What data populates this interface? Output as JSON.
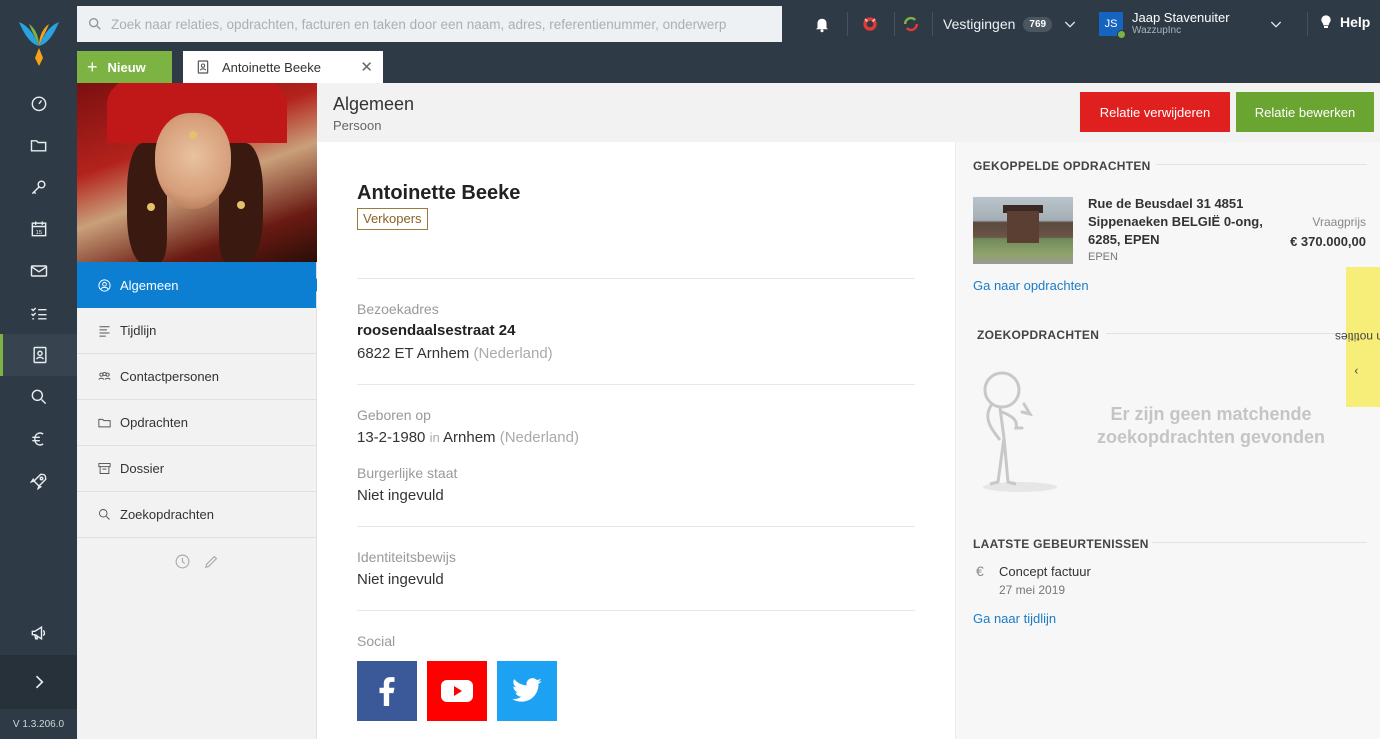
{
  "app": {
    "version": "V 1.3.206.0"
  },
  "search": {
    "placeholder": "Zoek naar relaties, opdrachten, facturen en taken door een naam, adres, referentienummer, onderwerp"
  },
  "topbar": {
    "vestigingen_label": "Vestigingen",
    "vestigingen_count": "769",
    "user_initials": "JS",
    "user_name": "Jaap Stavenuiter",
    "user_org": "WazzupInc",
    "help_label": "Help"
  },
  "tabs": {
    "new_label": "Nieuw",
    "open_tab": "Antoinette Beeke"
  },
  "subnav": {
    "items": [
      {
        "label": "Algemeen",
        "icon": "user-circle-icon"
      },
      {
        "label": "Tijdlijn",
        "icon": "lines-icon"
      },
      {
        "label": "Contactpersonen",
        "icon": "people-icon"
      },
      {
        "label": "Opdrachten",
        "icon": "folder-icon"
      },
      {
        "label": "Dossier",
        "icon": "archive-icon"
      },
      {
        "label": "Zoekopdrachten",
        "icon": "search-icon"
      }
    ]
  },
  "header": {
    "title": "Algemeen",
    "subtitle": "Persoon",
    "delete_label": "Relatie verwijderen",
    "edit_label": "Relatie bewerken"
  },
  "relation": {
    "name": "Antoinette Beeke",
    "tag": "Verkopers",
    "address_label": "Bezoekadres",
    "street": "roosendaalsestraat 24",
    "postal_city": "6822 ET Arnhem",
    "country": "(Nederland)",
    "born_label": "Geboren op",
    "born_date": "13-2-1980",
    "born_in": "in",
    "born_city": "Arnhem",
    "born_country": "(Nederland)",
    "civil_label": "Burgerlijke staat",
    "civil_value": "Niet ingevuld",
    "id_label": "Identiteitsbewijs",
    "id_value": "Niet ingevuld",
    "social_label": "Social"
  },
  "right_panel": {
    "linked_heading": "GEKOPPELDE OPDRACHTEN",
    "property_address": "Rue de Beusdael 31 4851 Sippenaeken BELGIË 0-ong, 6285, EPEN",
    "property_city": "EPEN",
    "price_label": "Vraagprijs",
    "price_value": "€ 370.000,00",
    "linked_link": "Ga naar opdrachten",
    "search_heading": "ZOEKOPDRACHTEN",
    "search_empty": "Er zijn geen matchende zoekopdrachten gevonden",
    "events_heading": "LAATSTE GEBEURTENISSEN",
    "event_icon": "€",
    "event_title": "Concept factuur",
    "event_date": "27 mei 2019",
    "events_link": "Ga naar tijdlijn"
  },
  "notes": {
    "label": "Geen notities"
  },
  "colors": {
    "rail": "#2e3a45",
    "accent_green": "#7cb342",
    "active_blue": "#0d7fd3",
    "danger_red": "#e0201f",
    "facebook": "#3b5998",
    "youtube": "#ff0000",
    "twitter": "#1da1f2"
  }
}
